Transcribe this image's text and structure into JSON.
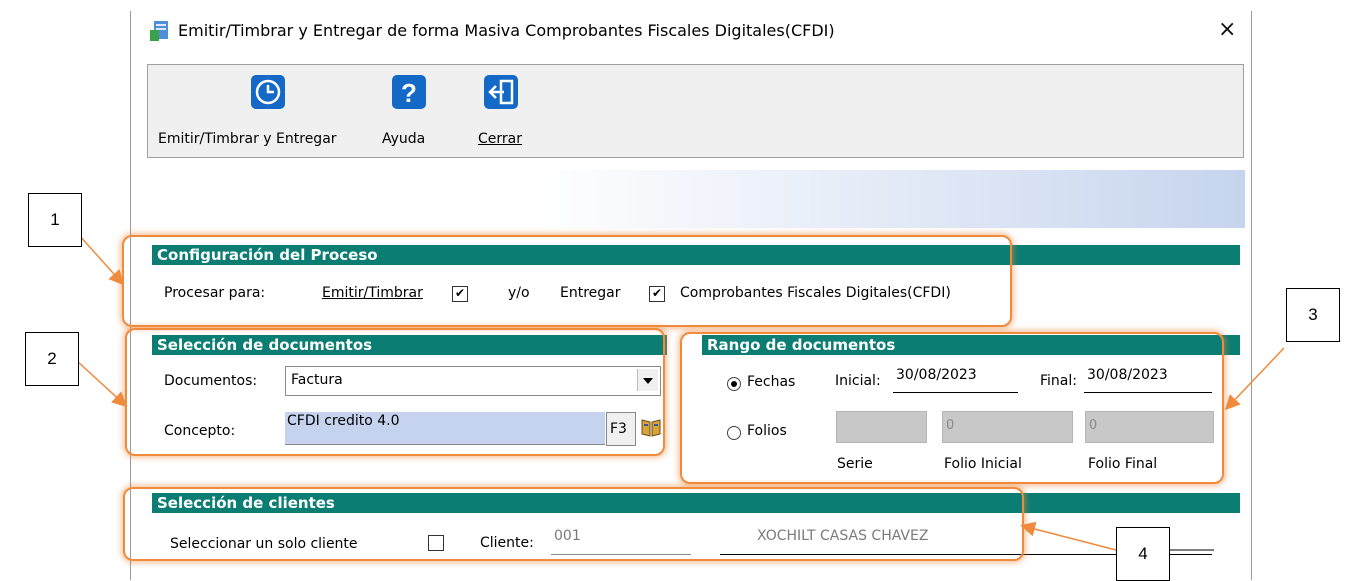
{
  "window": {
    "title": "Emitir/Timbrar y Entregar de forma Masiva Comprobantes Fiscales Digitales(CFDI)",
    "close_symbol": "×"
  },
  "toolbar": {
    "buttons": [
      {
        "label": "Emitir/Timbrar y Entregar",
        "icon": "clock-icon"
      },
      {
        "label": "Ayuda",
        "icon": "help-icon"
      },
      {
        "label": "Cerrar",
        "icon": "exit-door-icon"
      }
    ]
  },
  "config": {
    "title": "Configuración del Proceso",
    "procesar_label": "Procesar para:",
    "emitir_label": "Emitir/Timbrar",
    "emitir_checked": true,
    "yo_label": "y/o",
    "entregar_label": "Entregar",
    "entregar_checked": true,
    "cfdi_label": "Comprobantes Fiscales Digitales(CFDI)"
  },
  "seleccion_documentos": {
    "title": "Selección de documentos",
    "documentos_label": "Documentos:",
    "documentos_value": "Factura",
    "concepto_label": "Concepto:",
    "concepto_value": "CFDI credito 4.0",
    "f3_label": "F3"
  },
  "rango": {
    "title": "Rango de documentos",
    "fechas_label": "Fechas",
    "fechas_selected": true,
    "inicial_label": "Inicial:",
    "inicial_value": "30/08/2023",
    "final_label": "Final:",
    "final_value": "30/08/2023",
    "folios_label": "Folios",
    "serie_label": "Serie",
    "folio_inicial_label": "Folio Inicial",
    "folio_inicial_value": "0",
    "folio_final_label": "Folio Final",
    "folio_final_value": "0"
  },
  "clientes": {
    "title": "Selección de clientes",
    "solo_cliente_label": "Seleccionar un solo cliente",
    "solo_cliente_checked": false,
    "cliente_label": "Cliente:",
    "cliente_code": "001",
    "cliente_name": "XOCHILT CASAS CHAVEZ"
  },
  "callouts": [
    "1",
    "2",
    "3",
    "4"
  ],
  "colors": {
    "section_bar": "#0b7d73",
    "highlight": "#f08a3c",
    "icon_blue": "#1468c6",
    "concepto_bg": "#c5d3ee"
  }
}
